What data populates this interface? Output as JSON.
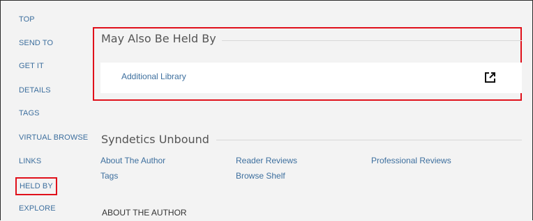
{
  "sidebar": {
    "items": [
      {
        "label": "TOP"
      },
      {
        "label": "SEND TO"
      },
      {
        "label": "GET IT"
      },
      {
        "label": "DETAILS"
      },
      {
        "label": "TAGS"
      },
      {
        "label": "VIRTUAL BROWSE"
      },
      {
        "label": "LINKS"
      },
      {
        "label": "HELD BY",
        "highlighted": true
      },
      {
        "label": "EXPLORE"
      }
    ]
  },
  "held_by": {
    "title": "May Also Be Held By",
    "library_name": "Additional Library",
    "icon": "external-link-icon"
  },
  "syndetics": {
    "title": "Syndetics Unbound",
    "links": [
      "About The Author",
      "Tags",
      "Reader Reviews",
      "Browse Shelf",
      "Professional Reviews"
    ],
    "subheading": "ABOUT THE AUTHOR"
  },
  "colors": {
    "link": "#3d6f9e",
    "highlight_border": "#e0101a",
    "background": "#f3f3f3",
    "card": "#ffffff"
  }
}
